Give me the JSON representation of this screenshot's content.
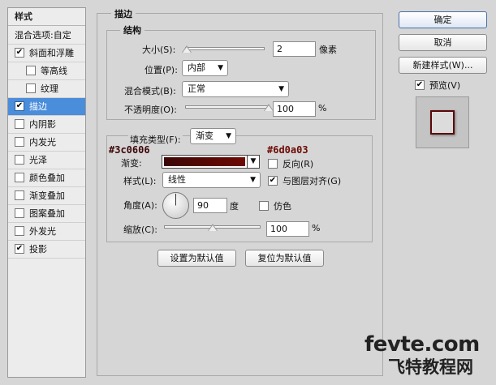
{
  "styles_panel": {
    "title": "样式",
    "blend_options": "混合选项:自定",
    "items": [
      {
        "label": "斜面和浮雕",
        "checked": true,
        "indent": false,
        "selected": false
      },
      {
        "label": "等高线",
        "checked": false,
        "indent": true,
        "selected": false
      },
      {
        "label": "纹理",
        "checked": false,
        "indent": true,
        "selected": false
      },
      {
        "label": "描边",
        "checked": true,
        "indent": false,
        "selected": true
      },
      {
        "label": "内阴影",
        "checked": false,
        "indent": false,
        "selected": false
      },
      {
        "label": "内发光",
        "checked": false,
        "indent": false,
        "selected": false
      },
      {
        "label": "光泽",
        "checked": false,
        "indent": false,
        "selected": false
      },
      {
        "label": "颜色叠加",
        "checked": false,
        "indent": false,
        "selected": false
      },
      {
        "label": "渐变叠加",
        "checked": false,
        "indent": false,
        "selected": false
      },
      {
        "label": "图案叠加",
        "checked": false,
        "indent": false,
        "selected": false
      },
      {
        "label": "外发光",
        "checked": false,
        "indent": false,
        "selected": false
      },
      {
        "label": "投影",
        "checked": true,
        "indent": false,
        "selected": false
      }
    ]
  },
  "stroke": {
    "title": "描边",
    "structure": {
      "title": "结构",
      "size_label": "大小(S):",
      "size_value": "2",
      "size_unit": "像素",
      "size_slider_fraction": 0.02,
      "position_label": "位置(P):",
      "position_value": "内部",
      "blend_label": "混合模式(B):",
      "blend_value": "正常",
      "opacity_label": "不透明度(O):",
      "opacity_value": "100",
      "opacity_unit": "%",
      "opacity_slider_fraction": 1.0
    },
    "fill": {
      "fill_type_label": "填充类型(F):",
      "fill_type_value": "渐变",
      "color_start": "#3c0606",
      "color_end": "#6d0a03",
      "gradient_label": "渐变:",
      "reverse_label": "反向(R)",
      "reverse_checked": false,
      "style_label": "样式(L):",
      "style_value": "线性",
      "align_label": "与图层对齐(G)",
      "align_checked": true,
      "angle_label": "角度(A):",
      "angle_value": "90",
      "angle_unit": "度",
      "dither_label": "仿色",
      "dither_checked": false,
      "scale_label": "缩放(C):",
      "scale_value": "100",
      "scale_unit": "%",
      "scale_slider_fraction": 0.5
    },
    "default_set_label": "设置为默认值",
    "default_reset_label": "复位为默认值"
  },
  "actions": {
    "ok_label": "确定",
    "cancel_label": "取消",
    "new_style_label": "新建样式(W)...",
    "preview_label": "预览(V)",
    "preview_checked": true
  },
  "watermark": {
    "top": "fevte.com",
    "bottom": "飞特教程网"
  }
}
